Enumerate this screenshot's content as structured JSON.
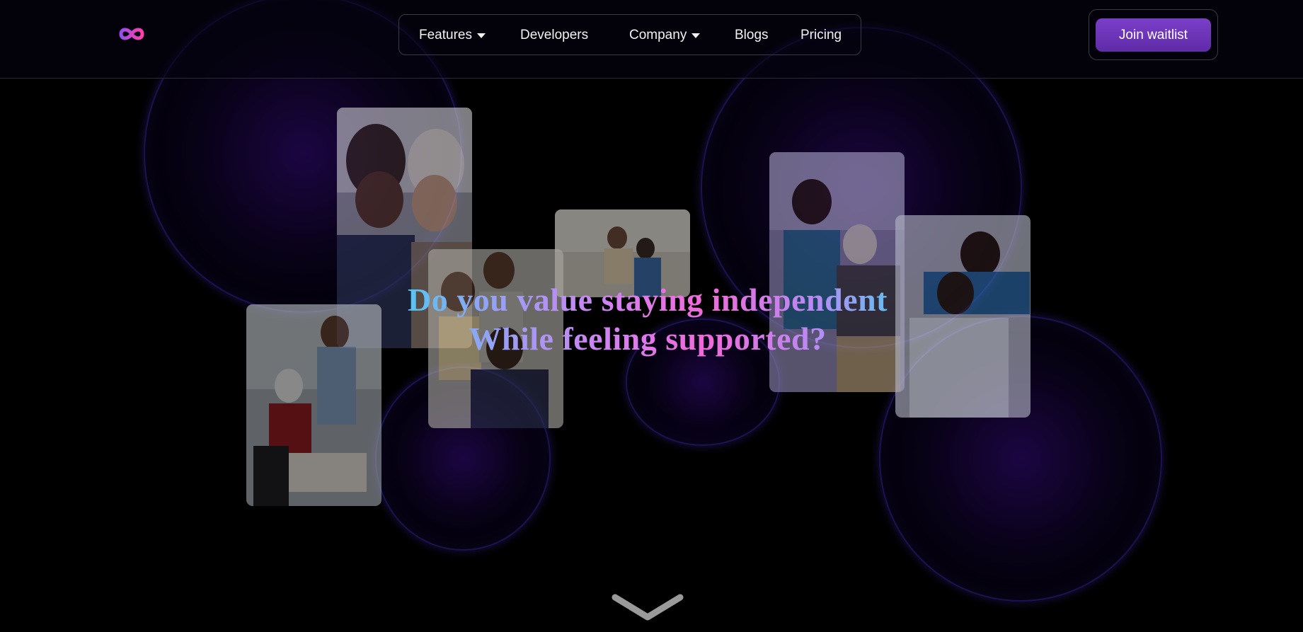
{
  "header": {
    "logo_icon": "infinity-logo-icon",
    "nav": {
      "items": [
        {
          "label": "Features",
          "has_dropdown": true
        },
        {
          "label": "Developers",
          "has_dropdown": false
        },
        {
          "label": "Company",
          "has_dropdown": true
        },
        {
          "label": "Blogs",
          "has_dropdown": false
        },
        {
          "label": "Pricing",
          "has_dropdown": false
        }
      ]
    },
    "cta_label": "Join waitlist"
  },
  "hero": {
    "headline_line1": "Do you value staying independent",
    "headline_line2": "While feeling supported?",
    "scroll_icon": "chevron-down-icon"
  },
  "colors": {
    "background": "#000000",
    "cta": "#6a33b8",
    "gradient_cyan": "#3ad6f0",
    "gradient_magenta": "#f06ad8",
    "orb": "#2a0a6a"
  }
}
